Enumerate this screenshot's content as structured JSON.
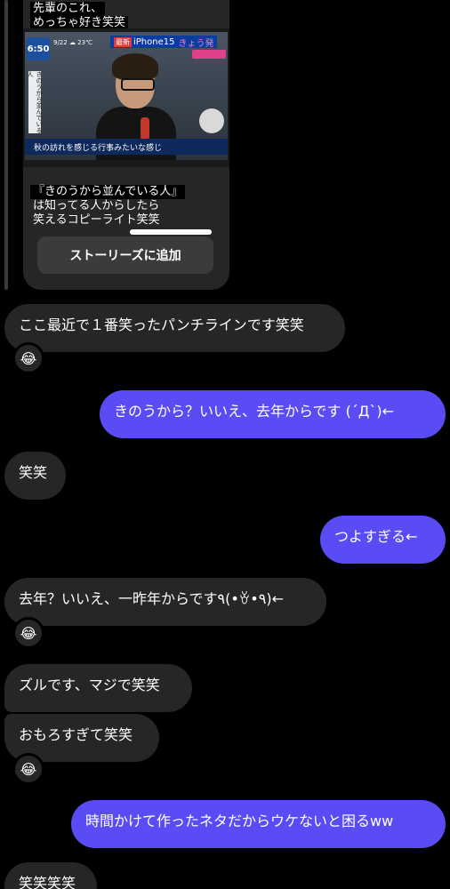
{
  "story": {
    "caption_top": [
      "先輩のこれ、",
      "めっちゃ好き笑笑"
    ],
    "caption_bottom": [
      "『きのうから並んでいる人』",
      "は知ってる人からしたら",
      "笑えるコピーライト笑笑"
    ],
    "tv": {
      "clock": "6:50",
      "weather": "9/22 ☁ 23℃",
      "headline_tag": "最新",
      "headline": "iPhone15",
      "headline_pink": "きょう発",
      "side_label": "きのうから並んでいる人",
      "subtitle": "秋の訪れを感じる行事みたいな感じ"
    },
    "add_button": "ストーリーズに追加"
  },
  "messages": [
    {
      "side": "received",
      "text": "ここ最近で１番笑ったパンチラインです笑笑",
      "reaction": "😂"
    },
    {
      "side": "sent",
      "text": "きのうから？いいえ、去年からです (´Д`)←"
    },
    {
      "side": "received",
      "text": "笑笑"
    },
    {
      "side": "sent",
      "text": "つよすぎる←"
    },
    {
      "side": "received",
      "text": "去年？いいえ、一昨年からです٩(•ꈊ•٩)←",
      "reaction": "😂"
    },
    {
      "side": "received",
      "text": "ズルです、マジで笑笑"
    },
    {
      "side": "received",
      "text": "おもろすぎて笑笑",
      "reaction": "😂"
    },
    {
      "side": "sent",
      "text": "時間かけて作ったネタだからウケないと困るww"
    },
    {
      "side": "received",
      "text": "笑笑笑笑"
    }
  ],
  "colors": {
    "sent_bubble": "#5a4cf5",
    "received_bubble": "#262626",
    "background": "#000000"
  }
}
